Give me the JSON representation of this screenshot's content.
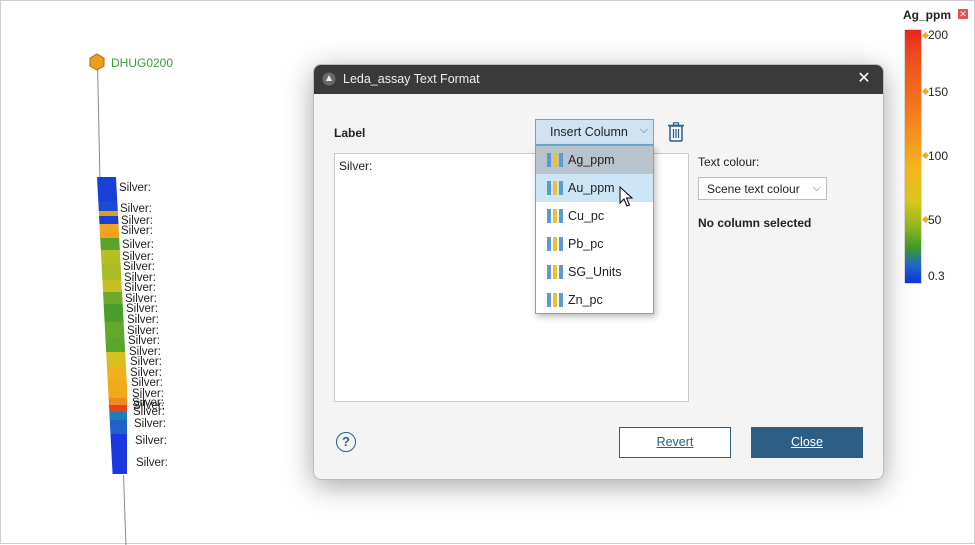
{
  "scene": {
    "hole_name": "DHUG0200",
    "interval_labels": [
      "Silver:",
      "Silver:",
      "Silver:",
      "Silver:",
      "Silver:",
      "Silver:",
      "Silver:",
      "Silver:",
      "Silver:",
      "Silver:",
      "Silver:",
      "Silver:",
      "Silver:",
      "Silver:",
      "Silver:",
      "Silver:",
      "Silver:",
      "Silver:",
      "Silver:",
      "Silver:",
      "Silver:",
      "Silver:",
      "Silver:",
      "Silver:",
      "Silver:"
    ]
  },
  "legend": {
    "title": "Ag_ppm",
    "ticks": [
      "200",
      "150",
      "100",
      "50",
      "0.3"
    ]
  },
  "dialog": {
    "title": "Leda_assay Text Format",
    "label_heading": "Label",
    "insert_column_label": "Insert Column",
    "text_content": "Silver:",
    "text_colour_label": "Text colour:",
    "text_colour_value": "Scene text colour",
    "no_column_text": "No column selected",
    "help_symbol": "?",
    "revert_label": "Revert",
    "close_label": "Close"
  },
  "dropdown": {
    "items": [
      "Ag_ppm",
      "Au_ppm",
      "Cu_pc",
      "Pb_pc",
      "SG_Units",
      "Zn_pc"
    ],
    "selected": "Ag_ppm",
    "hovered": "Au_ppm"
  },
  "colors": {
    "accent": "#2d5e85",
    "hole_name": "#3c9a3c",
    "titlebar": "#3a3a3a"
  }
}
